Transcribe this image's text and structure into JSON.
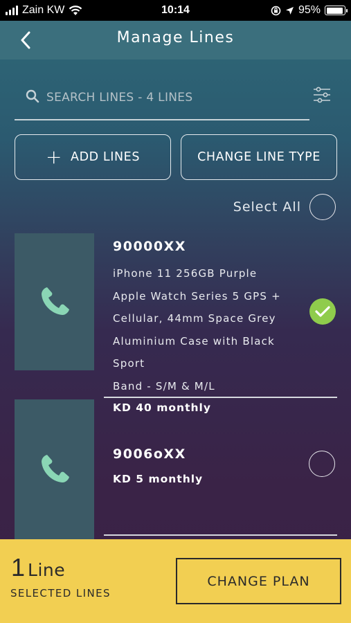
{
  "status_bar": {
    "carrier": "Zain KW",
    "time": "10:14",
    "battery": "95%",
    "battery_level": 0.95
  },
  "header": {
    "title": "Manage Lines",
    "back_icon": "chevron-left-icon"
  },
  "search": {
    "placeholder": "SEARCH LINES - 4 LINES",
    "value": ""
  },
  "actions": {
    "add_lines": "ADD LINES",
    "change_line_type": "CHANGE LINE TYPE",
    "select_all": "Select All"
  },
  "lines": [
    {
      "number": "90000XX",
      "description": [
        "iPhone 11 256GB Purple",
        "Apple Watch Series 5 GPS +",
        "Cellular, 44mm Space Grey",
        "Aluminium Case with Black Sport",
        "Band - S/M & M/L"
      ],
      "price": "KD 40 monthly",
      "selected": true
    },
    {
      "number": "9006oXX",
      "description": [],
      "price": "KD 5 monthly",
      "selected": false
    }
  ],
  "footer": {
    "count": "1",
    "count_unit": "Line",
    "count_label": "SELECTED LINES",
    "change_plan": "CHANGE PLAN"
  },
  "colors": {
    "accent_yellow": "#f2cf52",
    "check_green": "#8fcc4c",
    "phone_icon": "#8ad6b5"
  }
}
